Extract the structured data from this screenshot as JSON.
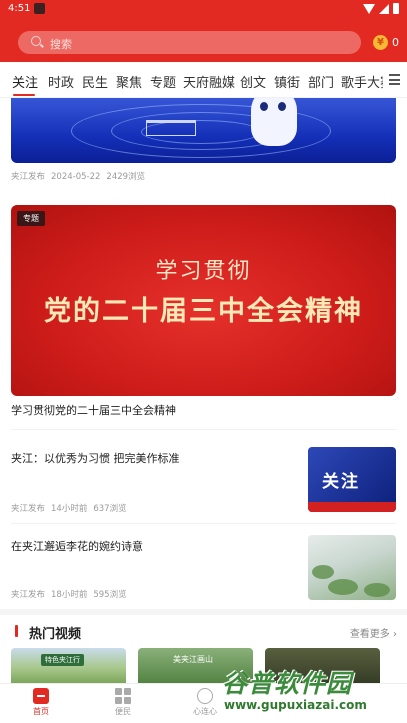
{
  "status_bar": {
    "time": "4:51"
  },
  "header": {
    "search_placeholder": "搜索",
    "coin_symbol": "¥",
    "coin_count": "0"
  },
  "tabs": [
    "关注",
    "时政",
    "民生",
    "聚焦",
    "专题",
    "天府融媒",
    "创文",
    "镇街",
    "部门",
    "歌手大赛"
  ],
  "feed": {
    "item1_meta": {
      "source": "夹江发布",
      "date": "2024-05-22",
      "views": "2429浏览"
    },
    "special": {
      "badge": "专题",
      "line1": "学习贯彻",
      "line2": "党的二十届三中全会精神",
      "title": "学习贯彻党的二十届三中全会精神"
    },
    "items": [
      {
        "title": "夹江：以优秀为习惯 把完美作标准",
        "source": "夹江发布",
        "time": "14小时前",
        "views": "637浏览",
        "thumb_text": "关注"
      },
      {
        "title": "在夹江邂逅李花的婉约诗意",
        "source": "夹江发布",
        "time": "18小时前",
        "views": "595浏览"
      }
    ]
  },
  "hot_videos": {
    "title": "热门视频",
    "more": "查看更多",
    "video_captions": [
      "特色夹江行",
      "美夹江画山"
    ]
  },
  "bottom_nav": [
    "首页",
    "便民",
    "心连心"
  ],
  "watermark": {
    "main": "谷普软件园",
    "url": "www.gupuxiazai.com"
  },
  "colors": {
    "brand_red": "#e32a22"
  }
}
